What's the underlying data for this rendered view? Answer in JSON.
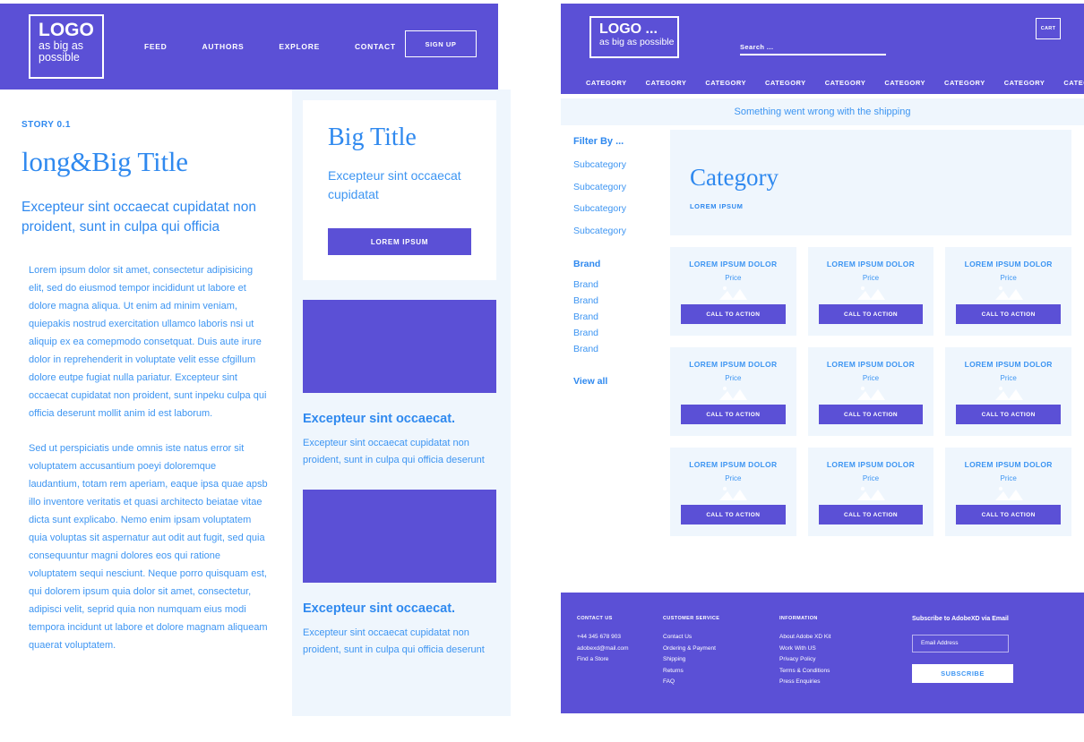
{
  "colors": {
    "purple": "#5B50D6",
    "blue": "#2f89ef",
    "light_blue_bg": "#EFF6FD",
    "white": "#ffffff"
  },
  "left_mockup": {
    "header": {
      "logo_main": "LOGO",
      "logo_sub": "as big as possible",
      "nav": [
        "FEED",
        "AUTHORS",
        "EXPLORE",
        "CONTACT"
      ],
      "signup_label": "SIGN UP"
    },
    "article": {
      "story_label": "STORY 0.1",
      "title": "long&Big Title",
      "subtitle": "Excepteur sint occaecat cupidatat non proident, sunt in culpa qui officia",
      "paragraph_1": "Lorem ipsum dolor sit amet, consectetur adipisicing elit, sed do eiusmod tempor incididunt ut labore et dolore magna aliqua. Ut enim ad minim veniam, quiepakis nostrud exercitation ullamco laboris nsi ut aliquip ex ea comepmodo consetquat. Duis aute irure dolor in reprehenderit in voluptate velit esse cfgillum dolore eutpe fugiat nulla pariatur. Excepteur sint occaecat cupidatat non proident, sunt inpeku culpa qui officia deserunt mollit anim id est laborum.",
      "paragraph_2": "Sed ut perspiciatis unde omnis iste natus error sit voluptatem accusantium poeyi doloremque laudantium, totam rem aperiam, eaque ipsa quae apsb illo inventore veritatis et quasi architecto beiatae vitae dicta sunt explicabo. Nemo enim ipsam voluptatem quia voluptas sit aspernatur aut odit aut fugit, sed quia consequuntur magni dolores eos qui ratione voluptatem sequi nesciunt. Neque porro quisquam est, qui dolorem ipsum quia dolor sit amet, consectetur, adipisci velit, seprid quia non numquam eius modi tempora incidunt ut labore et dolore magnam aliqueam quaerat voluptatem."
    },
    "sidebar": {
      "promo": {
        "title": "Big Title",
        "text": "Excepteur sint occaecat cupidatat",
        "button_label": "LOREM IPSUM"
      },
      "blocks": [
        {
          "heading": "Excepteur sint occaecat.",
          "text": "Excepteur sint occaecat cupidatat non proident, sunt in culpa qui officia deserunt"
        },
        {
          "heading": "Excepteur sint occaecat.",
          "text": "Excepteur sint occaecat cupidatat non proident, sunt in culpa qui officia deserunt"
        }
      ]
    }
  },
  "right_mockup": {
    "header": {
      "logo_main": "LOGO ...",
      "logo_sub": "as big as possible",
      "search_placeholder": "Search ...",
      "cart_label": "CART",
      "categories": [
        "CATEGORY",
        "CATEGORY",
        "CATEGORY",
        "CATEGORY",
        "CATEGORY",
        "CATEGORY",
        "CATEGORY",
        "CATEGORY",
        "CATEGORY"
      ]
    },
    "alert": "Something went wrong with the shipping",
    "filters": {
      "title": "Filter By ...",
      "subcategories": [
        "Subcategory",
        "Subcategory",
        "Subcategory",
        "Subcategory"
      ],
      "brand_head": "Brand",
      "brands": [
        "Brand",
        "Brand",
        "Brand",
        "Brand",
        "Brand"
      ],
      "view_all": "View all"
    },
    "catalog": {
      "banner_title": "Category",
      "banner_sub": "LOREM IPSUM",
      "products": [
        {
          "name": "LOREM IPSUM DOLOR",
          "price": "Price",
          "cta": "CALL TO ACTION"
        },
        {
          "name": "LOREM IPSUM DOLOR",
          "price": "Price",
          "cta": "CALL TO ACTION"
        },
        {
          "name": "LOREM IPSUM DOLOR",
          "price": "Price",
          "cta": "CALL TO ACTION"
        },
        {
          "name": "LOREM IPSUM DOLOR",
          "price": "Price",
          "cta": "CALL TO ACTION"
        },
        {
          "name": "LOREM IPSUM DOLOR",
          "price": "Price",
          "cta": "CALL TO ACTION"
        },
        {
          "name": "LOREM IPSUM DOLOR",
          "price": "Price",
          "cta": "CALL TO ACTION"
        },
        {
          "name": "LOREM IPSUM DOLOR",
          "price": "Price",
          "cta": "CALL TO ACTION"
        },
        {
          "name": "LOREM IPSUM DOLOR",
          "price": "Price",
          "cta": "CALL TO ACTION"
        },
        {
          "name": "LOREM IPSUM DOLOR",
          "price": "Price",
          "cta": "CALL TO ACTION"
        }
      ]
    },
    "footer": {
      "columns": [
        {
          "head": "CONTACT US",
          "items": [
            "+44 345 678 903",
            "adobexd@mail.com",
            "Find a Store"
          ]
        },
        {
          "head": "CUSTOMER SERVICE",
          "items": [
            "Contact Us",
            "Ordering & Payment",
            "Shipping",
            "Returns",
            "FAQ"
          ]
        },
        {
          "head": "INFORMATION",
          "items": [
            "About Adobe XD Kit",
            "Work With US",
            "Privacy Policy",
            "Terms & Conditions",
            "Press Enquiries"
          ]
        }
      ],
      "subscribe": {
        "head": "Subscribe to AdobeXD via Email",
        "placeholder": "Email Address",
        "button_label": "SUBSCRIBE"
      }
    }
  }
}
